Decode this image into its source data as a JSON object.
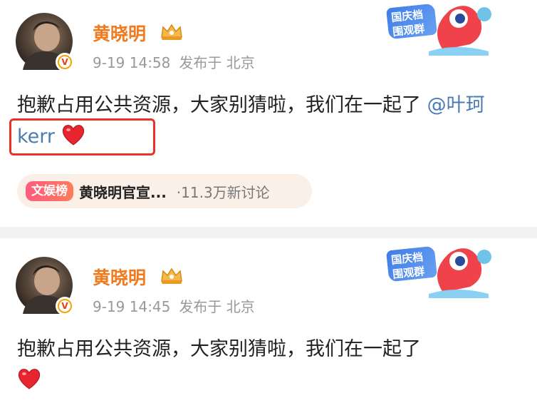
{
  "posts": [
    {
      "username": "黄晓明",
      "time": "9-19 14:58",
      "location": "发布于 北京",
      "content": "抱歉占用公共资源，大家别猜啦，我们在一起了 ",
      "mention": "@叶珂 kerr",
      "sticker_text": "国庆档 围观群众",
      "topic": {
        "tag": "文娱榜",
        "name": "黄晓明官宣...",
        "count": "·11.3万新讨论"
      }
    },
    {
      "username": "黄晓明",
      "time": "9-19 14:45",
      "location": "发布于 北京",
      "content": "抱歉占用公共资源，大家别猜啦，我们在一起了",
      "sticker_text": "国庆档 围观群众"
    }
  ],
  "icons": {
    "verified": "verified-v-badge-icon",
    "crown": "crown-icon",
    "heart": "red-heart-icon",
    "sticker": "holiday-mascot-sticker"
  },
  "colors": {
    "username": "#f07a1e",
    "mention": "#4a7bb5",
    "meta": "#999999",
    "highlight": "#e5352b",
    "heart": "#e8242e"
  }
}
